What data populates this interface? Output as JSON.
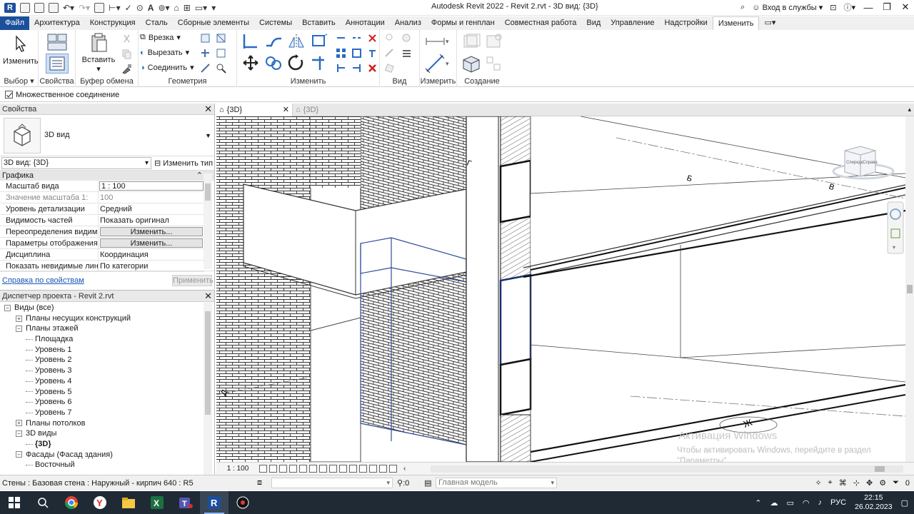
{
  "titlebar": {
    "title": "Autodesk Revit 2022 - Revit 2.rvt - 3D вид: {3D}",
    "sign_in": "Вход в службы",
    "help": "?"
  },
  "tabs": [
    {
      "label": "Файл"
    },
    {
      "label": "Архитектура"
    },
    {
      "label": "Конструкция"
    },
    {
      "label": "Сталь"
    },
    {
      "label": "Сборные элементы"
    },
    {
      "label": "Системы"
    },
    {
      "label": "Вставить"
    },
    {
      "label": "Аннотации"
    },
    {
      "label": "Анализ"
    },
    {
      "label": "Формы и генплан"
    },
    {
      "label": "Совместная работа"
    },
    {
      "label": "Вид"
    },
    {
      "label": "Управление"
    },
    {
      "label": "Надстройки"
    },
    {
      "label": "Изменить"
    }
  ],
  "ribbon": {
    "modify_label": "Изменить",
    "paste_label": "Вставить",
    "cut_into": "Врезка",
    "cut": "Вырезать",
    "join": "Соединить",
    "panels": {
      "select": "Выбор",
      "properties": "Свойства",
      "clipboard": "Буфер обмена",
      "geometry": "Геометрия",
      "modify": "Изменить",
      "view": "Вид",
      "measure": "Измерить",
      "create": "Создание"
    }
  },
  "options_bar": {
    "multiple_join": "Множественное соединение"
  },
  "properties": {
    "title": "Свойства",
    "type_name": "3D вид",
    "view_selector": "3D вид: {3D}",
    "edit_type": "Изменить тип",
    "group": "Графика",
    "rows": [
      {
        "name": "Масштаб вида",
        "value": "1 : 100"
      },
      {
        "name": "Значение масштаба    1:",
        "value": "100"
      },
      {
        "name": "Уровень детализации",
        "value": "Средний"
      },
      {
        "name": "Видимость частей",
        "value": "Показать оригинал"
      },
      {
        "name": "Переопределения видим...",
        "value": "Изменить..."
      },
      {
        "name": "Параметры отображения ...",
        "value": "Изменить..."
      },
      {
        "name": "Дисциплина",
        "value": "Координация"
      },
      {
        "name": "Показать невидимые лин...",
        "value": "По категории"
      }
    ],
    "help_link": "Справка по свойствам",
    "apply": "Применить"
  },
  "browser": {
    "title": "Диспетчер проекта - Revit 2.rvt",
    "nodes": [
      {
        "label": "Виды (все)",
        "level": 0,
        "toggle": "−"
      },
      {
        "label": "Планы несущих конструкций",
        "level": 1,
        "toggle": "+"
      },
      {
        "label": "Планы этажей",
        "level": 1,
        "toggle": "−"
      },
      {
        "label": "Площадка",
        "level": 2,
        "toggle": ""
      },
      {
        "label": "Уровень 1",
        "level": 2,
        "toggle": ""
      },
      {
        "label": "Уровень 2",
        "level": 2,
        "toggle": ""
      },
      {
        "label": "Уровень 3",
        "level": 2,
        "toggle": ""
      },
      {
        "label": "Уровень 4",
        "level": 2,
        "toggle": ""
      },
      {
        "label": "Уровень 5",
        "level": 2,
        "toggle": ""
      },
      {
        "label": "Уровень 6",
        "level": 2,
        "toggle": ""
      },
      {
        "label": "Уровень 7",
        "level": 2,
        "toggle": ""
      },
      {
        "label": "Планы потолков",
        "level": 1,
        "toggle": "+"
      },
      {
        "label": "3D виды",
        "level": 1,
        "toggle": "−"
      },
      {
        "label": "{3D}",
        "level": 2,
        "toggle": ""
      },
      {
        "label": "Фасады (Фасад здания)",
        "level": 1,
        "toggle": "−"
      },
      {
        "label": "Восточный",
        "level": 2,
        "toggle": ""
      }
    ]
  },
  "viewport": {
    "tab_active": "{3D}",
    "tab_inactive": "{3D}",
    "scale": "1 : 100",
    "viewcube_left": "Спереди",
    "viewcube_right": "Справа",
    "grid_labels": [
      "Б",
      "В",
      "Г",
      "Д",
      "Ж"
    ],
    "activation_title": "Активация Windows",
    "activation_text": "Чтобы активировать Windows, перейдите в раздел \"Параметры\"."
  },
  "statusbar": {
    "text": "Стены : Базовая стена : Наружный - кирпич 640 : R5",
    "counter": ":0",
    "model": "Главная модель",
    "filter_count": "0"
  },
  "taskbar": {
    "lang": "РУС",
    "time": "22:15",
    "date": "26.02.2023"
  }
}
